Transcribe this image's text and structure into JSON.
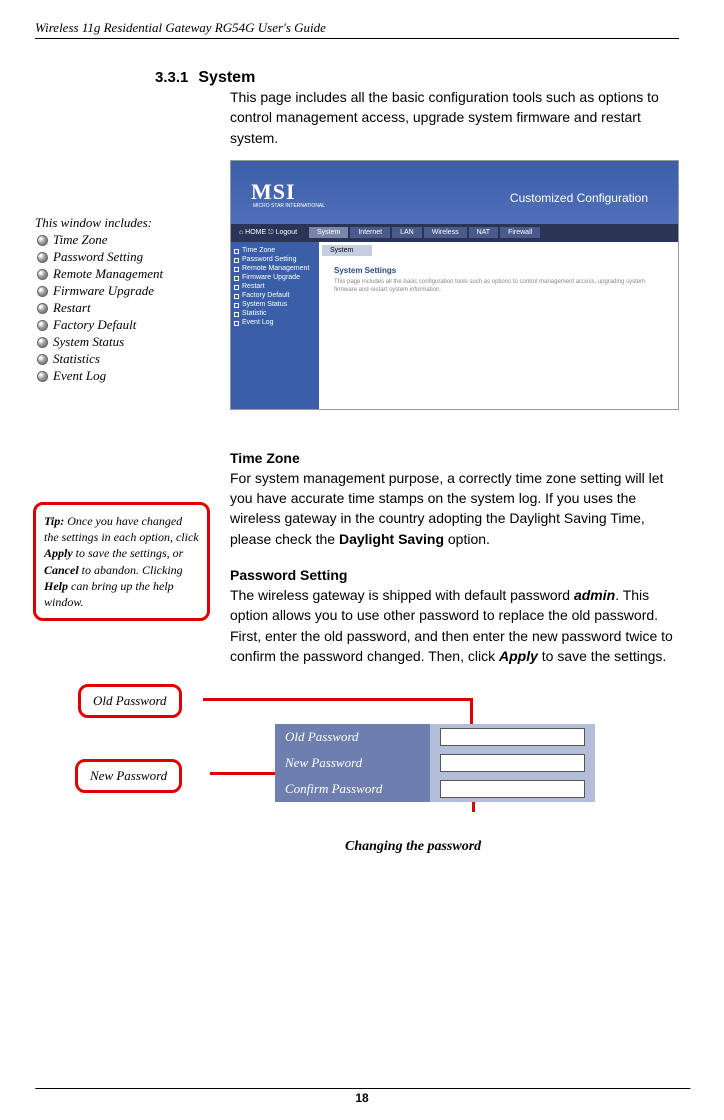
{
  "header": {
    "title": "Wireless 11g Residential Gateway RG54G User's Guide"
  },
  "section": {
    "number": "3.3.1",
    "title": "System",
    "intro": "This page includes all the basic configuration tools such as options to control management access, upgrade system firmware and restart system."
  },
  "sidebar": {
    "intro": "This window includes:",
    "items": [
      {
        "label": "Time Zone"
      },
      {
        "label": "Password Setting"
      },
      {
        "label": "Remote Management"
      },
      {
        "label": "Firmware Upgrade"
      },
      {
        "label": "Restart"
      },
      {
        "label": "Factory Default"
      },
      {
        "label": "System Status"
      },
      {
        "label": "Statistics"
      },
      {
        "label": "Event Log"
      }
    ]
  },
  "screenshot": {
    "logo": "MSI",
    "logo_sub": "MICRO STAR INTERNATIONAL",
    "banner": "Customized Configuration",
    "nav_home": "⌂ HOME   ⎋ Logout",
    "tabs": [
      "System",
      "Internet",
      "LAN",
      "Wireless",
      "NAT",
      "Firewall"
    ],
    "left_items": [
      "Time Zone",
      "Password Setting",
      "Remote Management",
      "Firmware Upgrade",
      "Restart",
      "Factory Default",
      "System Status",
      "Statistic",
      "Event Log"
    ],
    "content_tab": "System",
    "content_title": "System Settings",
    "content_desc": "This page includes all the basic configuration tools such as options to control management access, upgrading system firmware and restart system information."
  },
  "tip": {
    "prefix": "Tip:",
    "line1": " Once you have changed the settings in each option, click ",
    "apply": "Apply",
    "line2": " to save the settings, or ",
    "cancel": "Cancel",
    "line3": " to abandon.  Clicking ",
    "help": "Help",
    "line4": " can bring up the help window."
  },
  "timezone": {
    "title": "Time Zone",
    "text1": "For system management purpose, a correctly time zone setting will let you have accurate time stamps on the system log.  If you uses the wireless gateway in the country adopting the Daylight Saving Time, please check the ",
    "bold1": "Daylight Saving",
    "text2": " option."
  },
  "password": {
    "title": "Password Setting",
    "text1": "The wireless gateway is shipped with default password ",
    "admin": "admin",
    "text2": ".  This option allows you to use other password to replace the old password.  First, enter the old password, and then enter the new password twice to confirm the password changed.  Then, click ",
    "apply": "Apply",
    "text3": " to save the settings."
  },
  "pw_diagram": {
    "old_callout": "Old Password",
    "new_callout": "New Password",
    "row1": "Old Password",
    "row2": "New Password",
    "row3": "Confirm Password",
    "caption": "Changing the password"
  },
  "page_num": "18"
}
